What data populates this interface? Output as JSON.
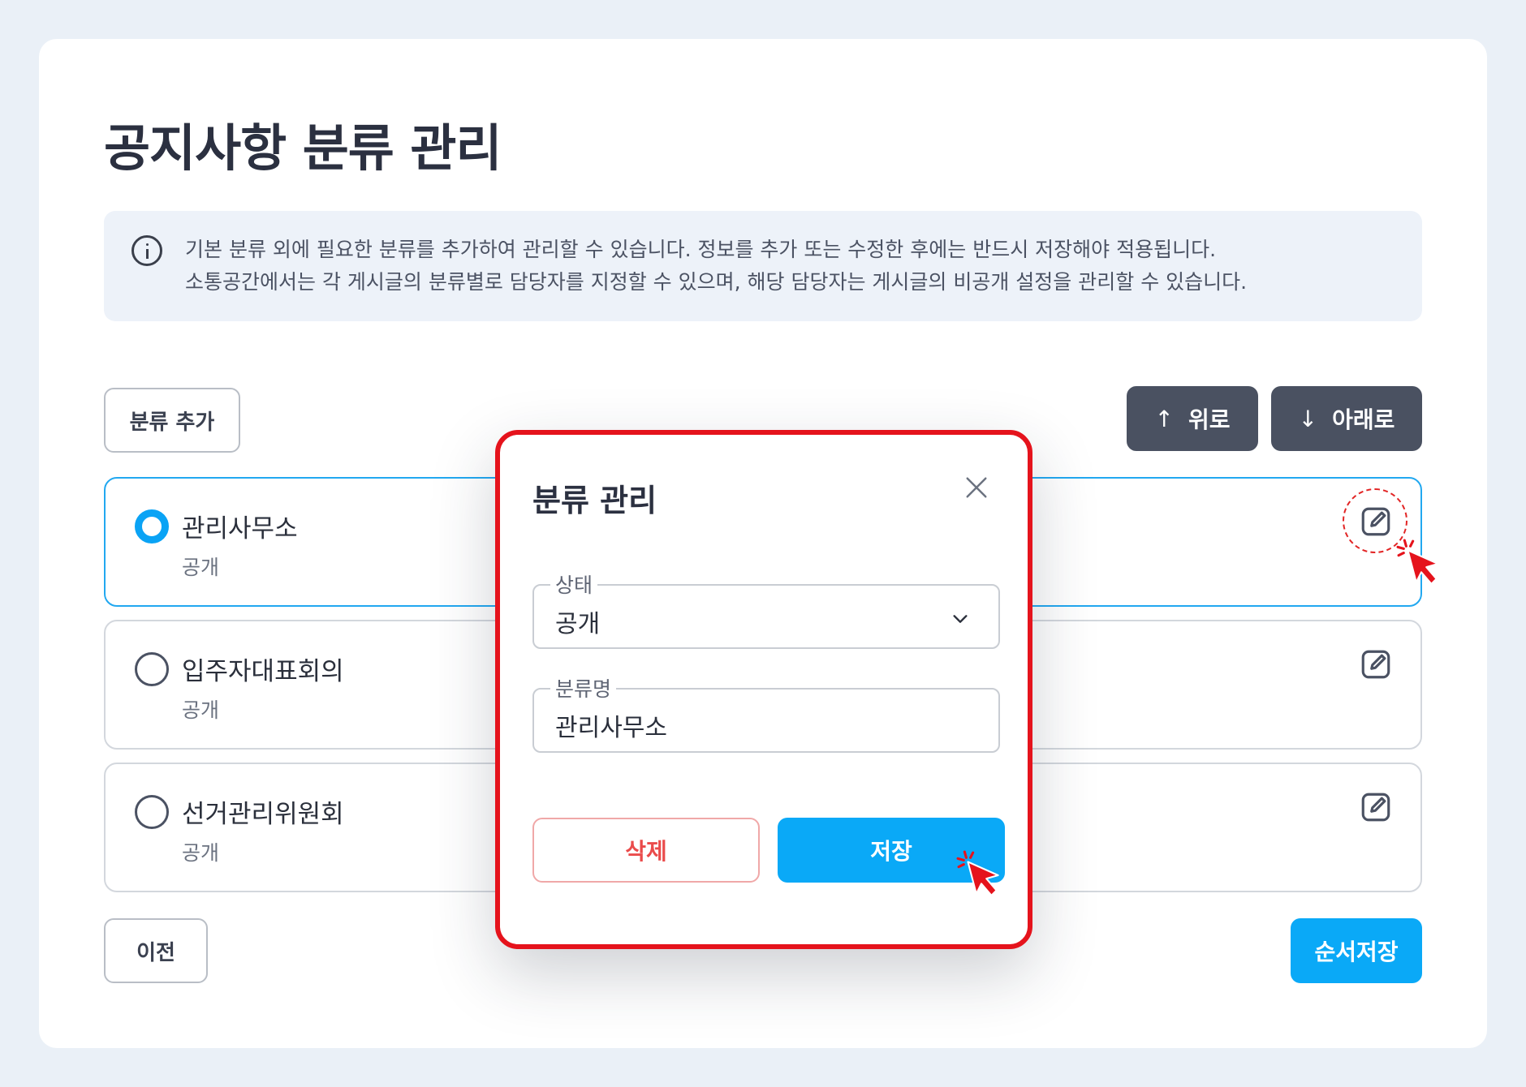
{
  "page": {
    "title": "공지사항 분류 관리",
    "info_lines": [
      "기본 분류 외에 필요한 분류를 추가하여 관리할 수 있습니다. 정보를 추가 또는 수정한 후에는 반드시 저장해야 적용됩니다.",
      "소통공간에서는 각 게시글의 분류별로 담당자를 지정할 수 있으며, 해당 담당자는 게시글의 비공개 설정을 관리할 수 있습니다."
    ]
  },
  "toolbar": {
    "add_label": "분류 추가",
    "up_label": "위로",
    "down_label": "아래로"
  },
  "categories": [
    {
      "name": "관리사무소",
      "status": "공개",
      "selected": true
    },
    {
      "name": "입주자대표회의",
      "status": "공개",
      "selected": false
    },
    {
      "name": "선거관리위원회",
      "status": "공개",
      "selected": false
    }
  ],
  "footer": {
    "prev_label": "이전",
    "save_order_label": "순서저장"
  },
  "modal": {
    "title": "분류 관리",
    "status_label": "상태",
    "status_value": "공개",
    "name_label": "분류명",
    "name_value": "관리사무소",
    "delete_label": "삭제",
    "save_label": "저장"
  },
  "colors": {
    "accent": "#0aa9f7",
    "dark_button": "#4a5161",
    "highlight": "#e5131c",
    "danger": "#ea4b4b"
  },
  "icons": [
    "info-icon",
    "arrow-up-icon",
    "arrow-down-icon",
    "edit-icon",
    "close-icon",
    "chevron-down-icon",
    "cursor-icon"
  ]
}
